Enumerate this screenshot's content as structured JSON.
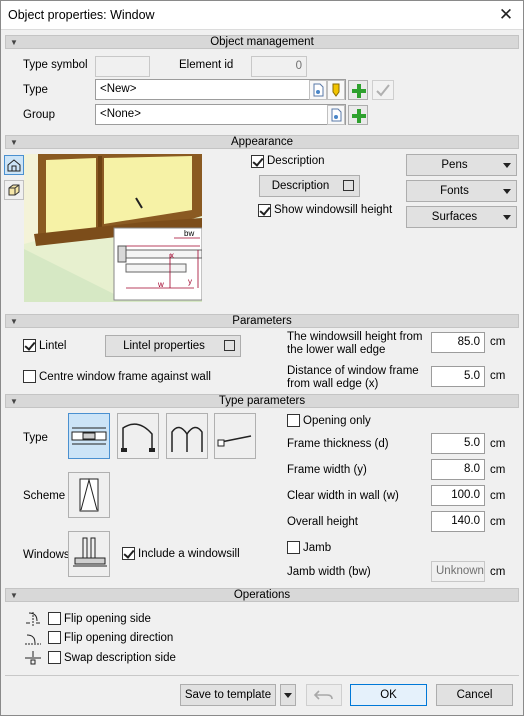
{
  "window": {
    "title": "Object properties: Window",
    "close_label": "✕"
  },
  "sections": {
    "object_management": "Object management",
    "appearance": "Appearance",
    "parameters": "Parameters",
    "type_parameters": "Type parameters",
    "operations": "Operations"
  },
  "object_management": {
    "type_symbol_label": "Type symbol",
    "type_symbol_value": "",
    "element_id_label": "Element id",
    "element_id_value": "0",
    "type_label": "Type",
    "type_value": "<New>",
    "group_label": "Group",
    "group_value": "<None>"
  },
  "appearance": {
    "description_checkbox_label": "Description",
    "description_checked": true,
    "description_button": "Description",
    "show_windowsill_label": "Show windowsill height",
    "show_windowsill_checked": true,
    "pens_button": "Pens",
    "fonts_button": "Fonts",
    "surfaces_button": "Surfaces",
    "preview_dim_bw": "bw",
    "preview_dim_x": "x",
    "preview_dim_y": "y",
    "preview_dim_w": "w"
  },
  "parameters": {
    "lintel_label": "Lintel",
    "lintel_checked": true,
    "lintel_properties_button": "Lintel properties",
    "centre_frame_label": "Centre window frame against wall",
    "centre_frame_checked": false,
    "windowsill_height_label": "The windowsill height from the lower wall edge",
    "windowsill_height_value": "85.0",
    "windowsill_height_unit": "cm",
    "distance_label": "Distance of window frame from wall edge (x)",
    "distance_value": "5.0",
    "distance_unit": "cm"
  },
  "type_parameters": {
    "type_label": "Type",
    "scheme_label": "Scheme",
    "windowsill_label": "Windowsill",
    "include_windowsill_label": "Include a windowsill",
    "include_windowsill_checked": true,
    "opening_only_label": "Opening only",
    "opening_only_checked": false,
    "frame_thickness_label": "Frame thickness (d)",
    "frame_thickness_value": "5.0",
    "frame_width_label": "Frame width (y)",
    "frame_width_value": "8.0",
    "clear_width_label": "Clear width in wall (w)",
    "clear_width_value": "100.0",
    "overall_height_label": "Overall height",
    "overall_height_value": "140.0",
    "jamb_label": "Jamb",
    "jamb_checked": false,
    "jamb_width_label": "Jamb width (bw)",
    "jamb_width_value": "Unknown>",
    "unit": "cm"
  },
  "operations": {
    "flip_side_label": "Flip opening side",
    "flip_direction_label": "Flip opening direction",
    "swap_description_label": "Swap description side"
  },
  "footer": {
    "save_template_button": "Save to template",
    "ok_button": "OK",
    "cancel_button": "Cancel"
  }
}
